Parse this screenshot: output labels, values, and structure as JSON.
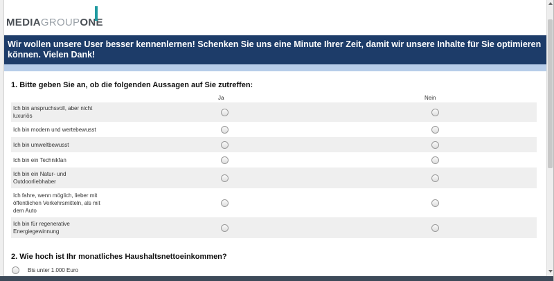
{
  "logo": {
    "part1": "MEDIA",
    "part2": "GROUP",
    "part3": "ONE"
  },
  "banner": {
    "line1": "Wir wollen unsere User besser kennenlernen! Schenken Sie uns eine Minute Ihrer Zeit, damit wir unsere Inhalte für Sie optimieren",
    "line2": "können. Vielen Dank!"
  },
  "question1": {
    "title": "1. Bitte geben Sie an, ob die folgenden Aussagen auf Sie zutreffen:",
    "columns": {
      "yes": "Ja",
      "no": "Nein"
    },
    "rows": [
      {
        "lines": [
          "Ich bin anspruchsvoll, aber nicht",
          "luxuriös"
        ]
      },
      {
        "lines": [
          "Ich bin modern und wertebewusst"
        ]
      },
      {
        "lines": [
          "Ich bin umweltbewusst"
        ]
      },
      {
        "lines": [
          "Ich bin ein Technikfan"
        ]
      },
      {
        "lines": [
          "Ich bin ein Natur- und",
          "Outdoorliebhaber"
        ]
      },
      {
        "lines": [
          "Ich fahre, wenn möglich, lieber mit",
          "öffentlichen Verkehrsmitteln, als mit",
          "dem Auto"
        ]
      },
      {
        "lines": [
          "Ich bin für regenerative",
          "Energiegewinnung"
        ]
      }
    ]
  },
  "question2": {
    "title": "2. Wie hoch ist Ihr monatliches Haushaltsnettoeinkommen?",
    "options": [
      "Bis unter 1.000 Euro"
    ]
  },
  "colors": {
    "banner": "#1d3c69",
    "banner_sub": "#b7cde9",
    "logo_bar": "#1f9aa0"
  }
}
